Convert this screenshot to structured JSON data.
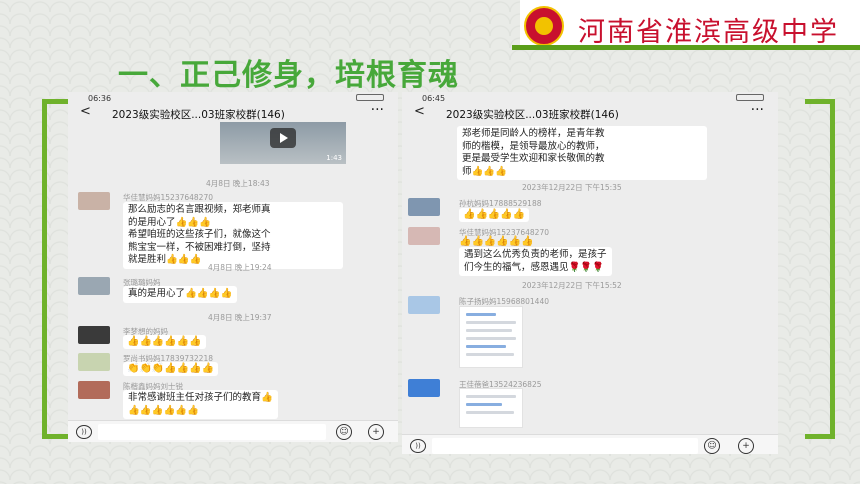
{
  "header": {
    "school_name": "河南省淮滨高级中学",
    "section_title": "一、正己修身，培根育魂",
    "accent_green": "#5a9e1a",
    "title_green": "#47a83a",
    "brand_red": "#c8102e"
  },
  "phone_left": {
    "time": "06:36",
    "back_icon": "<",
    "chat_title": "2023级实验校区...03班家校群(146)",
    "more_icon": "···",
    "video_duration": "1:43",
    "messages": [
      {
        "type": "time",
        "text": "4月8日 晚上18:43"
      },
      {
        "type": "msg",
        "name": "华佳慧妈妈15237648270",
        "lines": [
          "那么励志的名言跟视频，郑老师真",
          "的是用心了👍👍👍",
          "希望咱班的这些孩子们，就像这个",
          "熊宝宝一样，不被困难打倒，坚持",
          "就是胜利👍👍👍"
        ]
      },
      {
        "type": "time",
        "text": "4月8日 晚上19:24"
      },
      {
        "type": "msg",
        "name": "张璐璐妈妈",
        "lines": [
          "真的是用心了👍👍👍👍"
        ]
      },
      {
        "type": "time",
        "text": "4月8日 晚上19:37"
      },
      {
        "type": "msg",
        "name": "李梦想的妈妈",
        "lines": [
          "👍👍👍👍👍👍"
        ]
      },
      {
        "type": "msg",
        "name": "罗尚书妈妈17839732218",
        "lines": [
          "👏👏👏👍👍👍👍"
        ]
      },
      {
        "type": "msg",
        "name": "陈楷鑫妈妈刘士锐",
        "lines": [
          "非常感谢班主任对孩子们的教育👍",
          "👍👍👍👍👍👍"
        ]
      }
    ]
  },
  "phone_right": {
    "time": "06:45",
    "back_icon": "<",
    "chat_title": "2023级实验校区...03班家校群(146)",
    "more_icon": "···",
    "messages": [
      {
        "type": "msg",
        "name": "",
        "lines": [
          "郑老师是同龄人的榜样，是青年教",
          "师的楷模，是领导最放心的教师，",
          "更是最受学生欢迎和家长敬佩的教",
          "师👍👍👍"
        ]
      },
      {
        "type": "time",
        "text": "2023年12月22日 下午15:35"
      },
      {
        "type": "msg",
        "name": "孙杭妈妈17888529188",
        "lines": [
          "👍👍👍👍👍"
        ]
      },
      {
        "type": "msg",
        "name": "华佳慧妈妈15237648270",
        "lines": [
          "👍👍👍👍👍👍",
          "遇到这么优秀负责的老师，是孩子",
          "们今生的福气，感恩遇见🌹🌹🌹"
        ]
      },
      {
        "type": "time",
        "text": "2023年12月22日 下午15:52"
      },
      {
        "type": "msg",
        "name": "陈子扬妈妈15968801440",
        "lines": []
      },
      {
        "type": "msg",
        "name": "王佳蓓爸13524236825",
        "lines": []
      }
    ]
  }
}
